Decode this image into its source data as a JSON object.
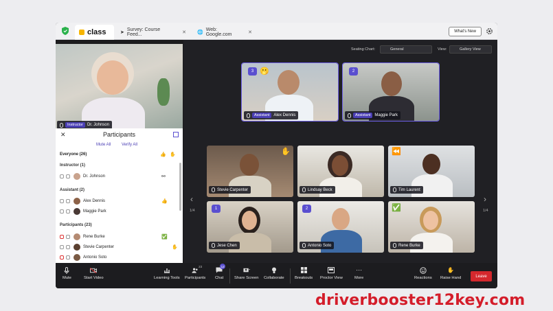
{
  "tabs": {
    "app_logo": "class",
    "survey": "Survey: Course Feed...",
    "web": "Web: Google.com",
    "whats_new": "What's New"
  },
  "instructor": {
    "role": "Instructor",
    "name": "Dr. Johnson"
  },
  "participants_panel": {
    "title": "Participants",
    "mute_all": "Mute All",
    "verify_all": "Verify All",
    "everyone": "Everyone (26)",
    "sections": {
      "instructor": "Instructor (1)",
      "assistant": "Assistant (2)",
      "participants": "Participants (23)"
    },
    "instructor_rows": [
      {
        "name": "Dr. Johnson"
      }
    ],
    "assistant_rows": [
      {
        "name": "Alex Dennis"
      },
      {
        "name": "Maggie Park"
      }
    ],
    "participant_rows": [
      {
        "name": "Rene Burke"
      },
      {
        "name": "Stevie Carpenter"
      },
      {
        "name": "Antonio Soto"
      }
    ]
  },
  "stage": {
    "seating_label": "Seating Chart:",
    "seating_value": "General",
    "view_label": "View:",
    "view_value": "Gallery View",
    "featured": [
      {
        "badge": "3",
        "role": "Assistant",
        "name": "Alex Dennis",
        "emoji": "🫢"
      },
      {
        "badge": "2",
        "role": "Assistant",
        "name": "Maggie Park"
      }
    ],
    "grid": [
      {
        "name": "Stevie Carpenter",
        "emoji": "✋"
      },
      {
        "name": "Lindsay Beck"
      },
      {
        "name": "Tim Laurent",
        "emoji": "⏪"
      },
      {
        "name": "Jese Chen",
        "badge": "1"
      },
      {
        "name": "Antonio Soto",
        "badge": "2"
      },
      {
        "name": "Rene Burke",
        "emoji": "✅"
      }
    ],
    "page_left": "1/4",
    "page_right": "1/4"
  },
  "toolbar": {
    "mute": "Mute",
    "start_video": "Start Video",
    "learning_tools": "Learning Tools",
    "participants": "Participants",
    "participants_count": "23",
    "chat": "Chat",
    "chat_count": "12",
    "share_screen": "Share Screen",
    "collaborate": "Collaborate",
    "breakouts": "Breakouts",
    "proctor_view": "Proctor View",
    "more": "More",
    "reactions": "Reactions",
    "raise_hand": "Raise Hand",
    "leave": "Leave"
  },
  "watermark": "driverbooster12key.com",
  "colors": {
    "accent": "#5a4fd0",
    "leave": "#d4282d",
    "watermark": "#d41d2a"
  }
}
